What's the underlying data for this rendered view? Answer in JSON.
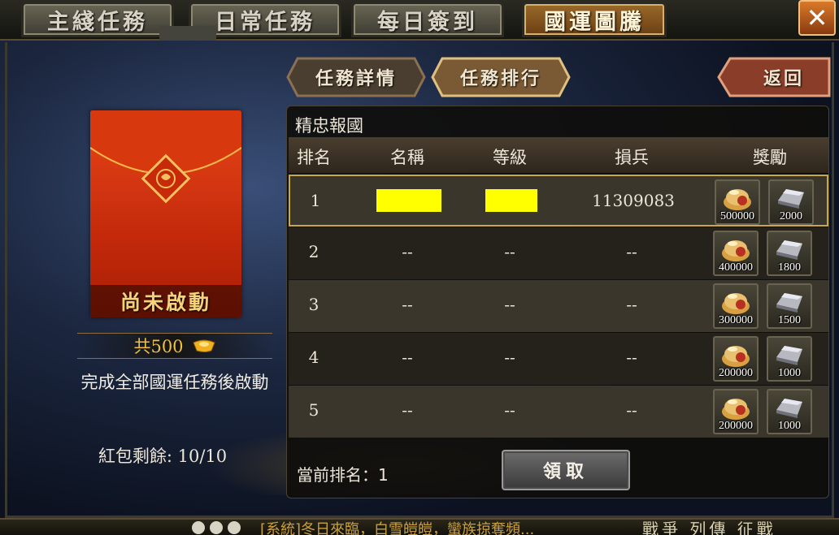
{
  "tabs": [
    {
      "label": "主綫任務",
      "active": false
    },
    {
      "label": "日常任務",
      "active": false
    },
    {
      "label": "每日簽到",
      "active": false
    },
    {
      "label": "國運圖騰",
      "active": true
    }
  ],
  "close_icon": "close-icon",
  "subtabs": [
    {
      "label": "任務詳情",
      "active": false
    },
    {
      "label": "任務排行",
      "active": true
    }
  ],
  "back_label": "返回",
  "red_packet": {
    "status": "尚未啟動",
    "total": "共500",
    "unlock_condition": "完成全部國運任務後啟動",
    "remaining": "紅包剩餘: 10/10"
  },
  "ranking": {
    "title": "精忠報國",
    "columns": [
      "排名",
      "名稱",
      "等級",
      "損兵",
      "獎勵"
    ],
    "rows": [
      {
        "rank": "1",
        "name": "",
        "level": "",
        "losses": "11309083",
        "reward_gold": "500000",
        "reward_silver": "2000",
        "redacted": true
      },
      {
        "rank": "2",
        "name": "--",
        "level": "--",
        "losses": "--",
        "reward_gold": "400000",
        "reward_silver": "1800",
        "redacted": false
      },
      {
        "rank": "3",
        "name": "--",
        "level": "--",
        "losses": "--",
        "reward_gold": "300000",
        "reward_silver": "1500",
        "redacted": false
      },
      {
        "rank": "4",
        "name": "--",
        "level": "--",
        "losses": "--",
        "reward_gold": "200000",
        "reward_silver": "1000",
        "redacted": false
      },
      {
        "rank": "5",
        "name": "--",
        "level": "--",
        "losses": "--",
        "reward_gold": "200000",
        "reward_silver": "1000",
        "redacted": false
      }
    ],
    "current_rank": "當前排名：1",
    "claim_label": "領取"
  },
  "chat": {
    "message": "[系統]冬日來臨，白雪皚皚，蠻族掠奪頻...",
    "right_text": "戰爭 列傳 征戰"
  },
  "colors": {
    "accent_gold": "#f0c040",
    "highlight_border": "#c8a84a",
    "redact_yellow": "#ffff00",
    "active_tab": "#9a6a2a"
  }
}
